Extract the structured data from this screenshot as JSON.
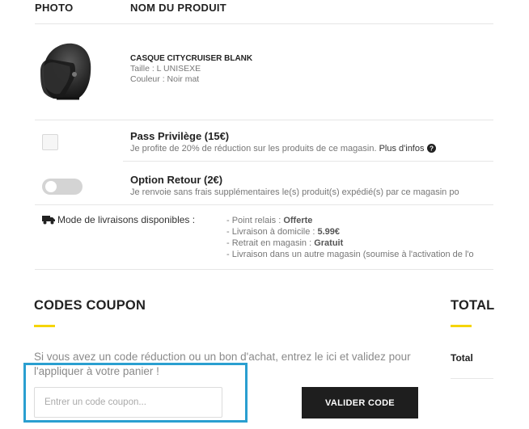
{
  "table": {
    "col_photo": "PHOTO",
    "col_product": "NOM DU PRODUIT"
  },
  "product": {
    "name": "CASQUE CITYCRUISER BLANK",
    "size": "Taille : L  UNISEXE",
    "color": "Couleur : Noir mat"
  },
  "options": {
    "pass": {
      "title": "Pass Privilège (15€)",
      "desc": "Je profite de 20% de réduction sur les produits de ce magasin.",
      "more_info": "Plus d'infos"
    },
    "return": {
      "title": "Option Retour (2€)",
      "desc": "Je renvoie sans frais supplémentaires le(s) produit(s) expédié(s) par ce magasin po"
    }
  },
  "delivery": {
    "label": "Mode de livraisons disponibles :",
    "items": [
      {
        "text": "- Point relais : ",
        "value": "Offerte"
      },
      {
        "text": "- Livraison à domicile : ",
        "value": "5.99€"
      },
      {
        "text": "- Retrait en magasin : ",
        "value": "Gratuit"
      },
      {
        "text": "- Livraison dans un autre magasin (soumise à l'activation de l'o",
        "value": ""
      }
    ]
  },
  "coupon": {
    "title": "CODES COUPON",
    "description": "Si vous avez un code réduction ou un bon d'achat, entrez le ici et validez pour l'appliquer à votre panier !",
    "placeholder": "Entrer un code coupon...",
    "value": "",
    "button_label": "VALIDER CODE"
  },
  "total": {
    "title": "TOTAL",
    "row_label": "Total"
  },
  "icons": {
    "truck": "truck-icon",
    "info": "question-circle-icon"
  },
  "colors": {
    "accent_yellow": "#f5d500",
    "highlight_blue": "#2a9fd0",
    "button_dark": "#1e1e1e"
  }
}
